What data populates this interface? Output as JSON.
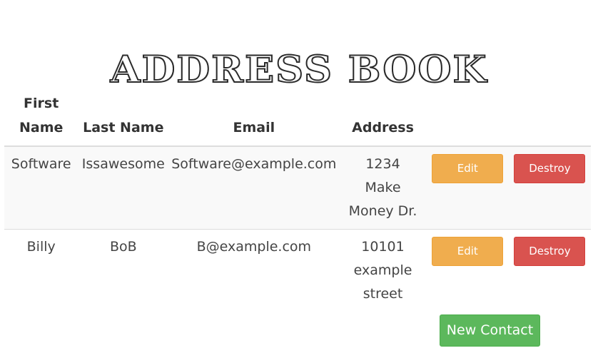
{
  "page": {
    "title": "ADDRESS BOOK"
  },
  "table": {
    "headers": {
      "first_name": "First Name",
      "last_name": "Last Name",
      "email": "Email",
      "address": "Address"
    },
    "rows": [
      {
        "first_name": "Software",
        "last_name": "Issawesome",
        "email": "Software@example.com",
        "address": "1234 Make Money Dr.",
        "edit_label": "Edit",
        "destroy_label": "Destroy"
      },
      {
        "first_name": "Billy",
        "last_name": "BoB",
        "email": "B@example.com",
        "address": "10101 example street",
        "edit_label": "Edit",
        "destroy_label": "Destroy"
      }
    ]
  },
  "actions": {
    "new_contact_label": "New Contact"
  },
  "colors": {
    "edit": "#f0ad4e",
    "destroy": "#d9534f",
    "new": "#5cb85c",
    "row_stripe": "#f9f9f9"
  }
}
